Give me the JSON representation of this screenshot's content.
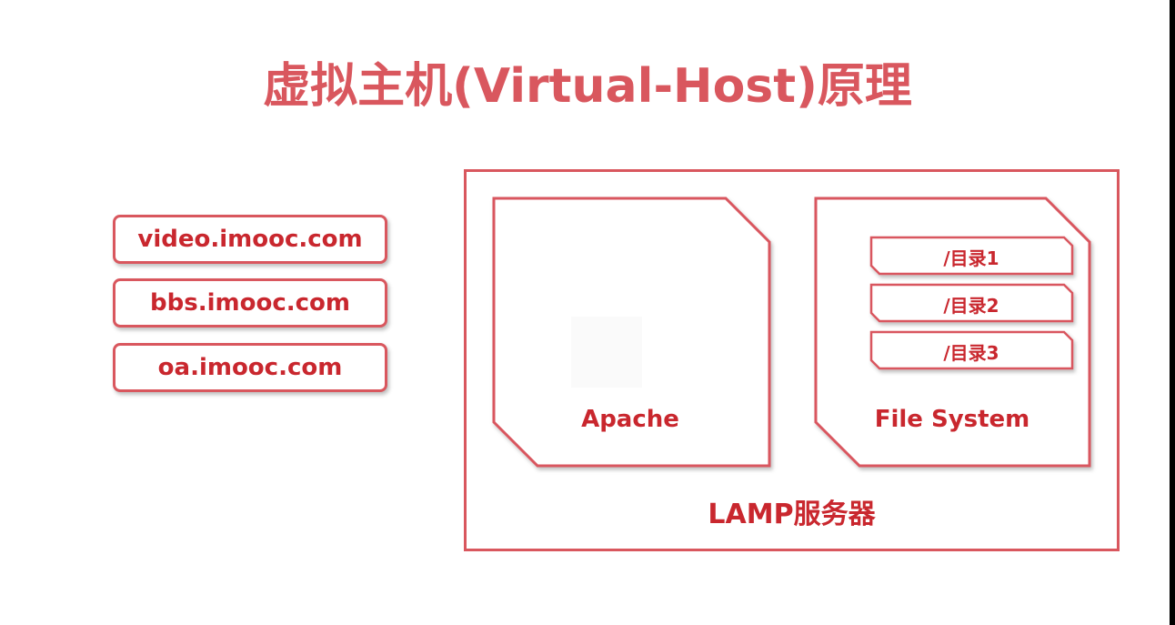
{
  "title": "虚拟主机(Virtual-Host)原理",
  "domains": [
    {
      "label": "video.imooc.com"
    },
    {
      "label": "bbs.imooc.com"
    },
    {
      "label": "oa.imooc.com"
    }
  ],
  "server": {
    "label": "LAMP服务器",
    "apache_label": "Apache",
    "filesystem_label": "File System",
    "directories": [
      {
        "label": "/目录1"
      },
      {
        "label": "/目录2"
      },
      {
        "label": "/目录3"
      }
    ]
  },
  "colors": {
    "accent": "#d9575e",
    "text": "#c9272e"
  }
}
